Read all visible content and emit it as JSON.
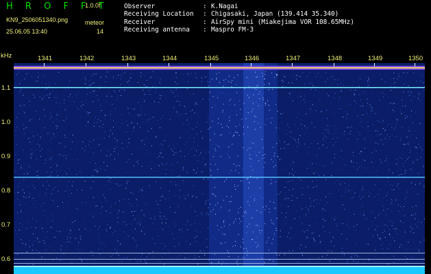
{
  "header": {
    "app_title": "H R O F F T",
    "version": "1.0.0f",
    "filename": "KN9_2506051340.png",
    "mode_label": "meteor",
    "timestamp": "25.06.05 13:40",
    "count": "14",
    "info_rows": [
      {
        "label": "Observer",
        "value": "K.Nagai"
      },
      {
        "label": "Receiving Location",
        "value": "Chigasaki, Japan (139.414 35.340)"
      },
      {
        "label": "Receiver",
        "value": "AirSpy mini (Miakejima VOR 108.65MHz)"
      },
      {
        "label": "Receiving antenna",
        "value": "Maspro FM-3"
      }
    ]
  },
  "axes": {
    "y_unit": "kHz",
    "y_ticks": [
      "1.1",
      "1.0",
      "0.9",
      "0.8",
      "0.7",
      "0.6"
    ],
    "x_ticks": [
      "1341",
      "1342",
      "1343",
      "1344",
      "1345",
      "1346",
      "1347",
      "1348",
      "1349",
      "1350"
    ]
  },
  "colors": {
    "background": "#000000",
    "plot_bg": "#0a1d66",
    "title": "#00e000",
    "label": "#f2f27a",
    "text": "#ffffff",
    "carrier": "#7ff0ff",
    "baseline": "#19c8ff"
  }
}
